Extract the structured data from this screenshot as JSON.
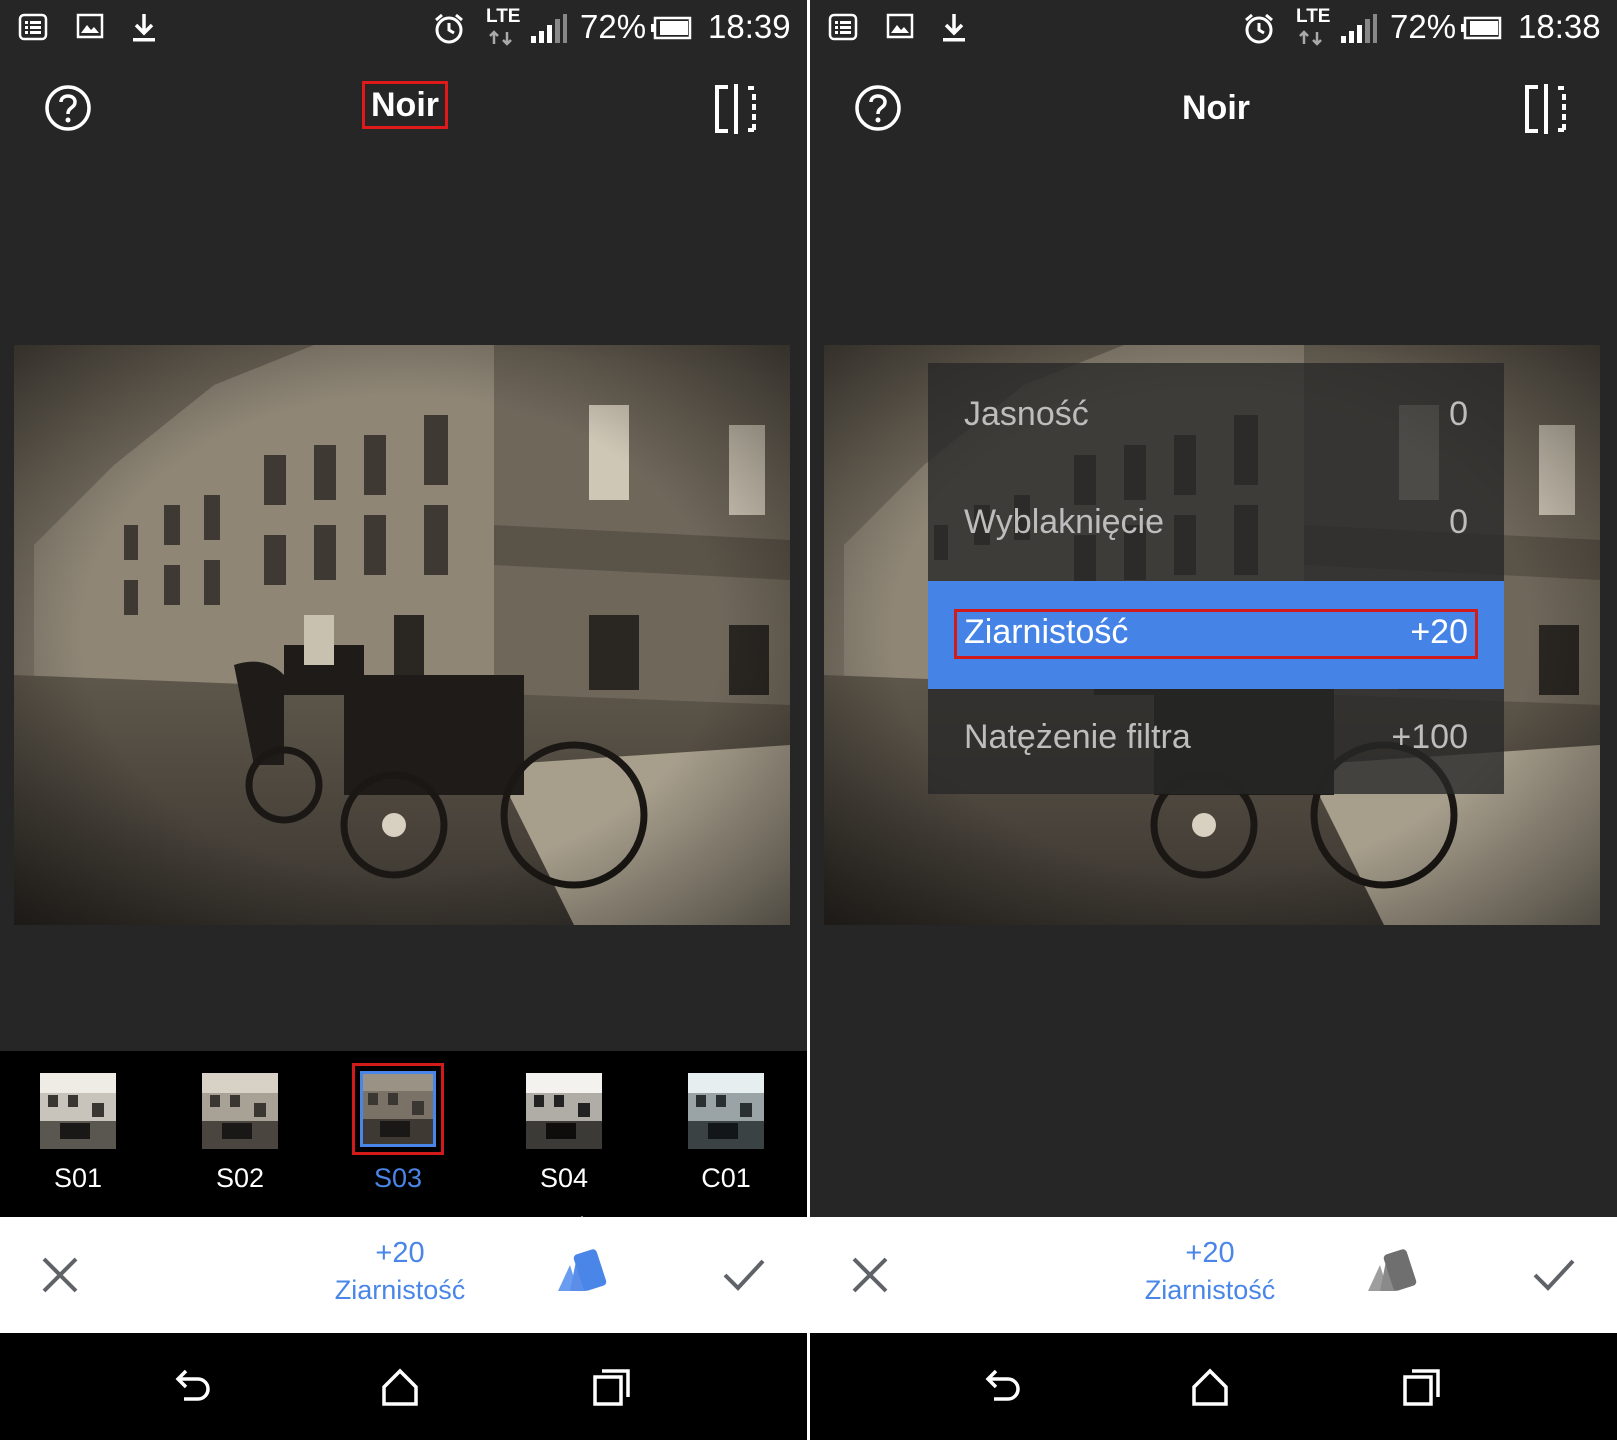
{
  "left_screen": {
    "status": {
      "lte": "LTE",
      "battery": "72%",
      "time": "18:39"
    },
    "header": {
      "title": "Noir"
    },
    "filters": [
      {
        "label": "S01"
      },
      {
        "label": "S02"
      },
      {
        "label": "S03",
        "selected": true
      },
      {
        "label": "S04"
      },
      {
        "label": "C01"
      }
    ],
    "toolbar": {
      "value": "+20",
      "param": "Ziarnistość"
    }
  },
  "right_screen": {
    "status": {
      "lte": "LTE",
      "battery": "72%",
      "time": "18:38"
    },
    "header": {
      "title": "Noir"
    },
    "params": [
      {
        "label": "Jasność",
        "value": "0"
      },
      {
        "label": "Wyblaknięcie",
        "value": "0"
      },
      {
        "label": "Ziarnistość",
        "value": "+20",
        "selected": true
      },
      {
        "label": "Natężenie filtra",
        "value": "+100"
      }
    ],
    "toolbar": {
      "value": "+20",
      "param": "Ziarnistość"
    }
  },
  "colors": {
    "accent": "#4a86e8",
    "highlight": "#d11a1a",
    "background": "#262626"
  }
}
